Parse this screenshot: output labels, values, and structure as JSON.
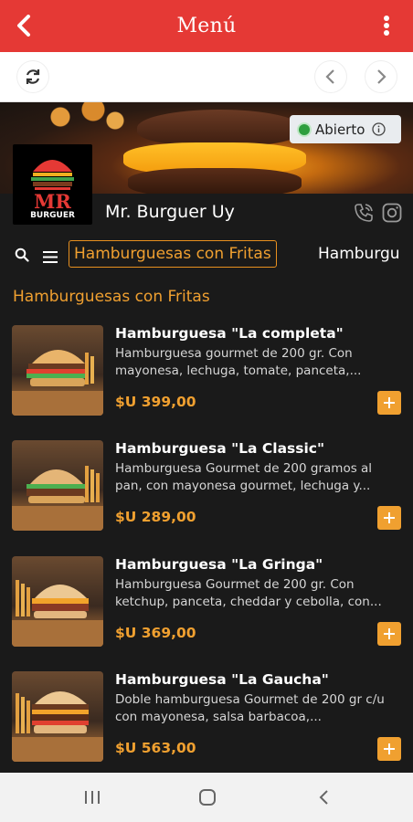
{
  "appbar": {
    "title": "Menú"
  },
  "hero": {
    "status": "Abierto"
  },
  "brand": {
    "name": "Mr. Burguer Uy",
    "logo_text_top": "MR",
    "logo_text_bottom": "BURGUER"
  },
  "categories": {
    "active": "Hamburguesas con Fritas",
    "next": "Hamburgu"
  },
  "section": {
    "title": "Hamburguesas con Fritas"
  },
  "products": [
    {
      "name": "Hamburguesa \"La completa\"",
      "desc": "Hamburguesa gourmet de 200 gr. Con mayonesa, lechuga, tomate, panceta,...",
      "price": "$U 399,00"
    },
    {
      "name": "Hamburguesa \"La Classic\"",
      "desc": "Hamburguesa Gourmet de 200 gramos al pan, con mayonesa gourmet, lechuga y...",
      "price": "$U 289,00"
    },
    {
      "name": "Hamburguesa \"La Gringa\"",
      "desc": "Hamburguesa Gourmet de 200 gr. Con ketchup, panceta, cheddar y cebolla, con...",
      "price": "$U 369,00"
    },
    {
      "name": "Hamburguesa \"La Gaucha\"",
      "desc": "Doble hamburguesa Gourmet de 200 gr c/u con mayonesa, salsa barbacoa,...",
      "price": "$U 563,00"
    }
  ],
  "colors": {
    "appbar": "#e53935",
    "accent": "#f0a030",
    "background": "#1a1a1a",
    "open": "#2e9e3e"
  }
}
